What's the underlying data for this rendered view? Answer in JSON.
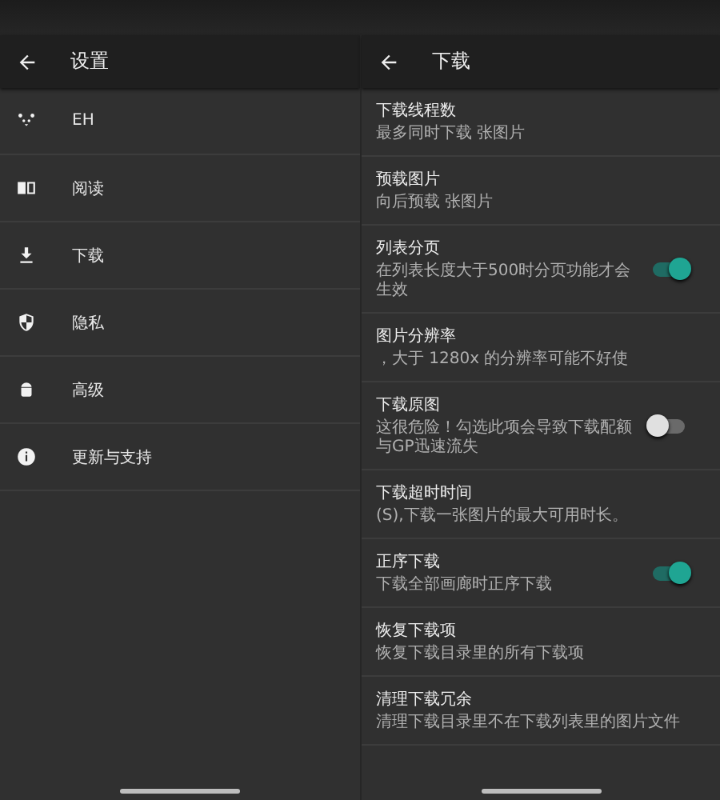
{
  "settings_pane": {
    "title": "设置",
    "items": [
      {
        "label": "EH"
      },
      {
        "label": "阅读"
      },
      {
        "label": "下载"
      },
      {
        "label": "隐私"
      },
      {
        "label": "高级"
      },
      {
        "label": "更新与支持"
      }
    ]
  },
  "download_pane": {
    "title": "下载",
    "items": [
      {
        "kind": "text",
        "title": "下载线程数",
        "summary": "最多同时下载 张图片"
      },
      {
        "kind": "text",
        "title": "预载图片",
        "summary": "向后预载 张图片"
      },
      {
        "kind": "switch",
        "title": "列表分页",
        "summary": "在列表长度大于500时分页功能才会生效",
        "on": true
      },
      {
        "kind": "text",
        "title": "图片分辨率",
        "summary": "，大于 1280x 的分辨率可能不好使"
      },
      {
        "kind": "switch",
        "title": "下载原图",
        "summary": "这很危险！勾选此项会导致下载配额与GP迅速流失",
        "on": false
      },
      {
        "kind": "text",
        "title": "下载超时时间",
        "summary": "(S),下载一张图片的最大可用时长。"
      },
      {
        "kind": "switch",
        "title": "正序下载",
        "summary": "下载全部画廊时正序下载",
        "on": true
      },
      {
        "kind": "text",
        "title": "恢复下载项",
        "summary": "恢复下载目录里的所有下载项"
      },
      {
        "kind": "text",
        "title": "清理下载冗余",
        "summary": "清理下载目录里不在下载列表里的图片文件"
      }
    ]
  }
}
